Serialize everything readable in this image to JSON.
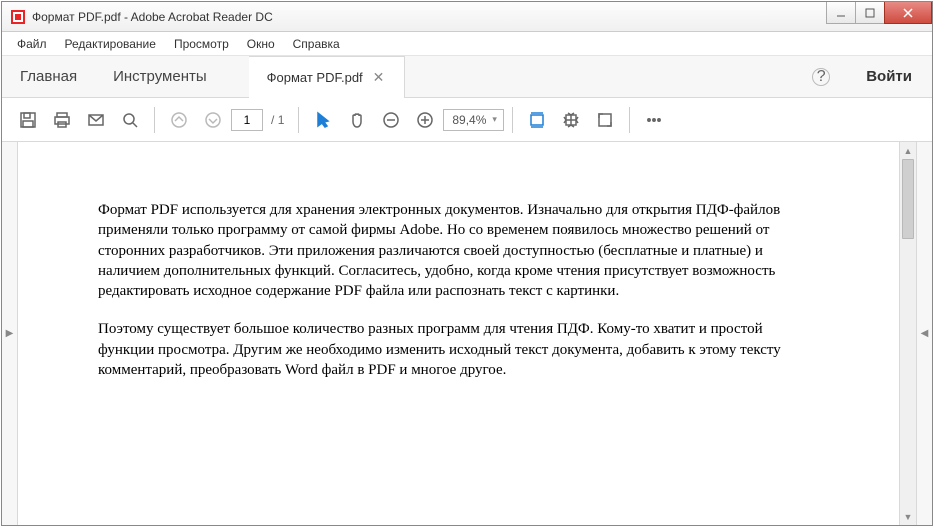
{
  "titlebar": {
    "title": "Формат PDF.pdf - Adobe Acrobat Reader DC"
  },
  "menubar": {
    "items": [
      "Файл",
      "Редактирование",
      "Просмотр",
      "Окно",
      "Справка"
    ]
  },
  "tabbar": {
    "home": "Главная",
    "tools": "Инструменты",
    "doc_tab": "Формат PDF.pdf",
    "login": "Войти"
  },
  "toolbar": {
    "page_current": "1",
    "page_sep": "/",
    "page_total": "1",
    "zoom": "89,4%"
  },
  "document": {
    "para1": "Формат PDF используется для хранения электронных документов. Изначально для открытия ПДФ-файлов применяли только программу от самой фирмы Adobe. Но со временем появилось множество решений от сторонних разработчиков. Эти приложения различаются своей доступностью (бесплатные и платные) и наличием дополнительных функций. Согласитесь, удобно, когда кроме чтения присутствует возможность редактировать исходное содержание PDF файла или распознать текст с картинки.",
    "para2": "Поэтому существует большое количество разных программ для чтения ПДФ. Кому-то хватит и простой функции просмотра. Другим же необходимо изменить исходный текст документа, добавить к этому тексту комментарий, преобразовать Word файл в PDF и многое другое."
  }
}
